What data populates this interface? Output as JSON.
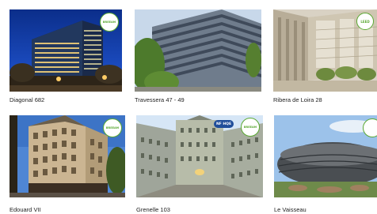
{
  "gallery": {
    "items": [
      {
        "caption": "Diagonal 682",
        "badge": "BREEAM"
      },
      {
        "caption": "Travessera 47 - 49",
        "badge": ""
      },
      {
        "caption": "Ribera de Loira 28",
        "badge": "LEED"
      },
      {
        "caption": "Edouard VII",
        "badge": "BREEAM"
      },
      {
        "caption": "Grenelle 103",
        "badge": "BREEAM",
        "badge2": "NF HQE"
      },
      {
        "caption": "Le Vaisseau",
        "badge": ""
      }
    ]
  },
  "colors": {
    "badge_green": "#5aa832",
    "caption_text": "#222222"
  }
}
